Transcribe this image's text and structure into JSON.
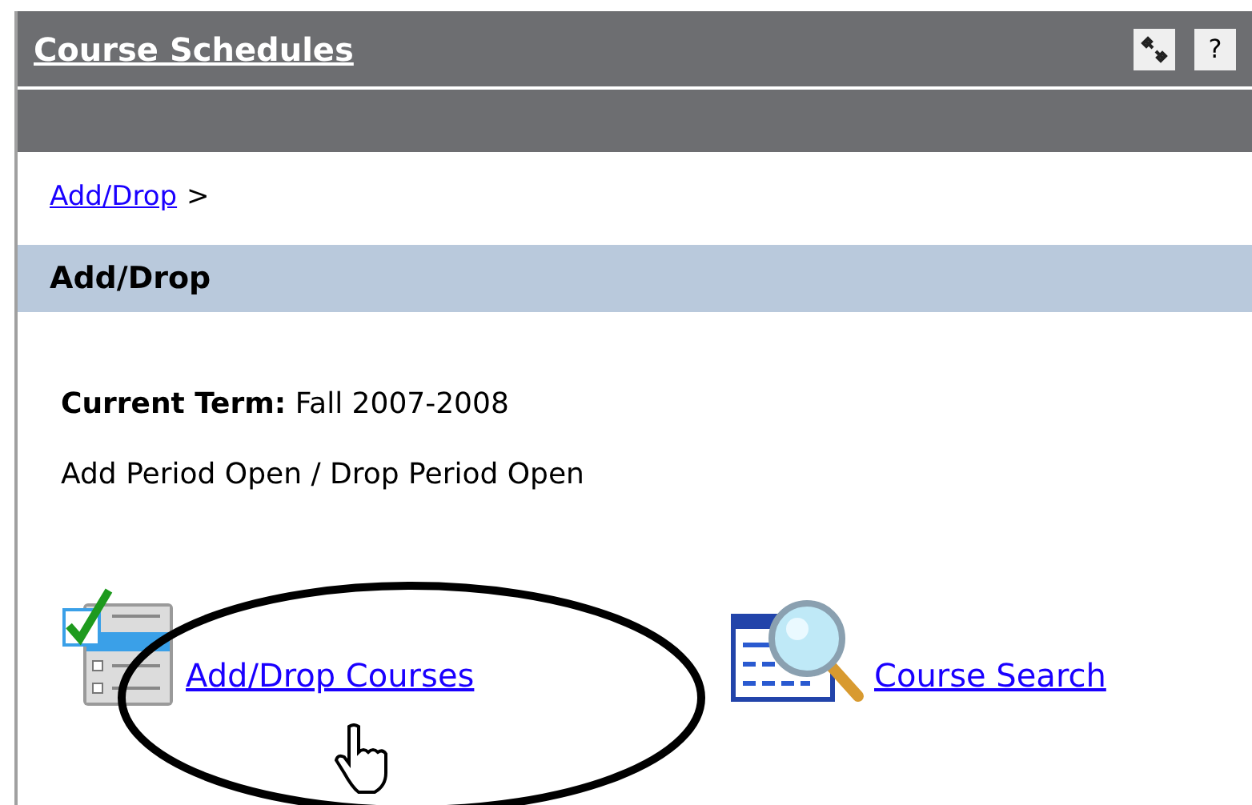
{
  "portlet": {
    "title": "Course Schedules",
    "help_label": "?"
  },
  "breadcrumb": {
    "link": "Add/Drop",
    "separator": ">"
  },
  "section": {
    "title": "Add/Drop"
  },
  "term": {
    "label": "Current Term:",
    "value": "Fall 2007-2008"
  },
  "status": "Add Period Open / Drop Period Open",
  "links": [
    {
      "kind": "add-drop",
      "label": "Add/Drop Courses"
    },
    {
      "kind": "search",
      "label": "Course Search"
    }
  ]
}
